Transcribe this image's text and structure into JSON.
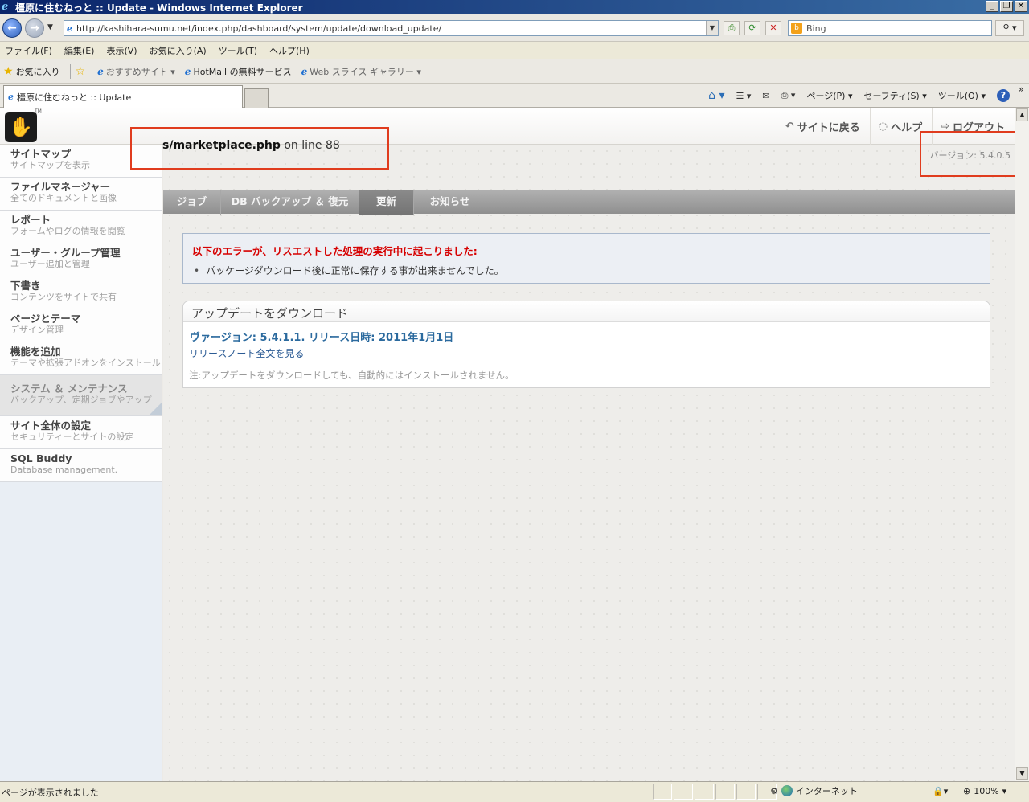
{
  "window": {
    "title": "橿原に住むねっと :: Update - Windows Internet Explorer",
    "buttons": [
      "_",
      "❐",
      "✕"
    ]
  },
  "address": {
    "url": "http://kashihara-sumu.net/index.php/dashboard/system/update/download_update/",
    "search_placeholder": "Bing"
  },
  "menu": [
    "ファイル(F)",
    "編集(E)",
    "表示(V)",
    "お気に入り(A)",
    "ツール(T)",
    "ヘルプ(H)"
  ],
  "favorites": {
    "label": "お気に入り",
    "items": [
      "おすすめサイト ▾",
      "HotMail の無料サービス",
      "Web スライス ギャラリー ▾"
    ]
  },
  "tab": {
    "title": "橿原に住むねっと :: Update"
  },
  "commands": {
    "page": "ページ(P) ▾",
    "safety": "セーフティ(S) ▾",
    "tools": "ツール(O) ▾",
    "help_symbol": "?"
  },
  "header": {
    "back_to_site": "サイトに戻る",
    "help": "ヘルプ",
    "logout": "ログアウト"
  },
  "sidebar": {
    "items": [
      {
        "title": "サイトマップ",
        "desc": "サイトマップを表示"
      },
      {
        "title": "ファイルマネージャー",
        "desc": "全てのドキュメントと画像"
      },
      {
        "title": "レポート",
        "desc": "フォームやログの情報を閲覧"
      },
      {
        "title": "ユーザー・グループ管理",
        "desc": "ユーザー追加と管理"
      },
      {
        "title": "下書き",
        "desc": "コンテンツをサイトで共有"
      },
      {
        "title": "ページとテーマ",
        "desc": "デザイン管理"
      },
      {
        "title": "機能を追加",
        "desc": "テーマや拡張アドオンをインストール"
      },
      {
        "title": "システム ＆ メンテナンス",
        "desc": "バックアップ、定期ジョブやアップ"
      },
      {
        "title": "サイト全体の設定",
        "desc": "セキュリティーとサイトの設定"
      },
      {
        "title": "SQL Buddy",
        "desc": "Database management."
      }
    ]
  },
  "main": {
    "error_file": "s/marketplace.php",
    "error_line": " on line 88",
    "version": "バージョン: 5.4.0.5",
    "tabs": [
      "ジョブ",
      "DB バックアップ ＆ 復元",
      "更新",
      "お知らせ"
    ],
    "alert_title": "以下のエラーが、リスエストした処理の実行中に起こりました:",
    "alert_item": "パッケージダウンロード後に正常に保存する事が出来ませんでした。",
    "panel_title": "アップデートをダウンロード",
    "panel_version": "ヴァージョン: 5.4.1.1. リリース日時: 2011年1月1日",
    "release_notes": "リリースノート全文を見る",
    "note": "注:アップデートをダウンロードしても、自動的にはインストールされません。"
  },
  "status": {
    "text": "ページが表示されました",
    "zone": "インターネット",
    "zoom": "100%"
  }
}
